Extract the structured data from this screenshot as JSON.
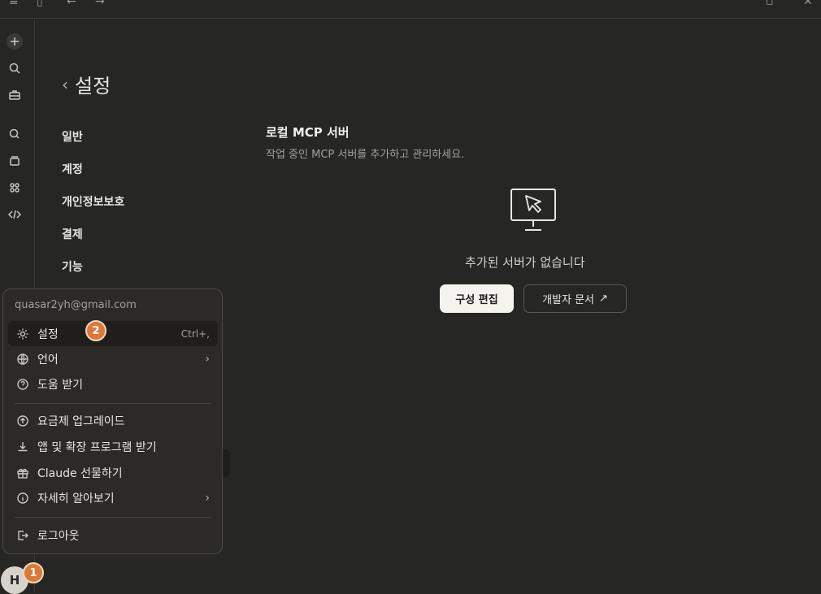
{
  "settings": {
    "title": "설정",
    "nav": [
      "일반",
      "계정",
      "개인정보보호",
      "결제",
      "기능"
    ]
  },
  "mcp": {
    "title": "로컬 MCP 서버",
    "subtitle": "작업 중인 MCP 서버를 추가하고 관리하세요.",
    "empty_message": "추가된 서버가 없습니다",
    "edit_config_label": "구성 편집",
    "dev_docs_label": "개발자 문서",
    "dev_docs_icon": "↗"
  },
  "menu": {
    "email": "quasar2yh@gmail.com",
    "items": [
      {
        "label": "설정",
        "shortcut": "Ctrl+,"
      },
      {
        "label": "언어"
      },
      {
        "label": "도움 받기"
      },
      {
        "label": "요금제 업그레이드"
      },
      {
        "label": "앱 및 확장 프로그램 받기"
      },
      {
        "label": "Claude 선물하기"
      },
      {
        "label": "자세히 알아보기"
      },
      {
        "label": "로그아웃"
      }
    ]
  },
  "avatar": {
    "initial": "H"
  },
  "badges": {
    "one": "1",
    "two": "2"
  },
  "colors": {
    "accent": "#d97a3a",
    "background": "#262624",
    "menu": "#2b2a27"
  }
}
